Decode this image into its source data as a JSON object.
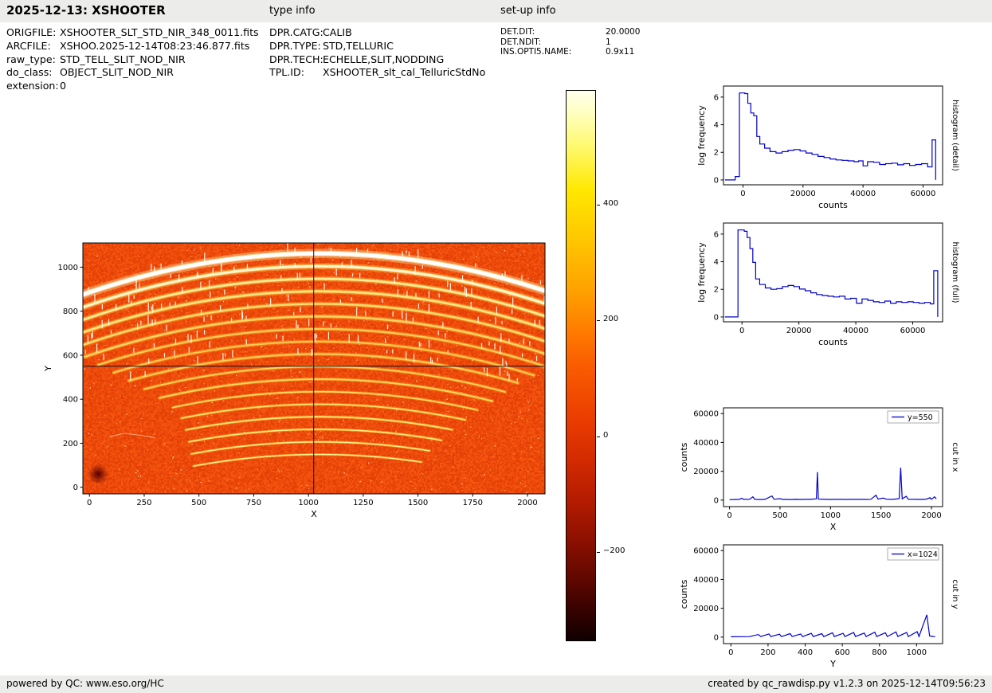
{
  "header": {
    "title": "2025-12-13: XSHOOTER",
    "type_info_heading": "type info",
    "setup_info_heading": "set-up info",
    "file_info": [
      {
        "label": "ORIGFILE:",
        "value": "XSHOOTER_SLT_STD_NIR_348_0011.fits"
      },
      {
        "label": "ARCFILE:",
        "value": "XSHOO.2025-12-14T08:23:46.877.fits"
      },
      {
        "label": "raw_type:",
        "value": "STD_TELL_SLIT_NOD_NIR"
      },
      {
        "label": "do_class:",
        "value": "OBJECT_SLIT_NOD_NIR"
      },
      {
        "label": "extension:",
        "value": "0"
      }
    ],
    "type_info": [
      {
        "label": "DPR.CATG:",
        "value": "CALIB"
      },
      {
        "label": "DPR.TYPE:",
        "value": "STD,TELLURIC"
      },
      {
        "label": "DPR.TECH:",
        "value": "ECHELLE,SLIT,NODDING"
      },
      {
        "label": "TPL.ID:",
        "value": "XSHOOTER_slt_cal_TelluricStdNo"
      }
    ],
    "setup_info": [
      {
        "label": "DET.DIT:",
        "value": "20.0000"
      },
      {
        "label": "DET.NDIT:",
        "value": "1"
      },
      {
        "label": "INS.OPTI5.NAME:",
        "value": "0.9x11"
      }
    ]
  },
  "footer": {
    "left": "powered by QC: www.eso.org/HC",
    "right": "created by qc_rawdisp.py v1.2.3 on 2025-12-14T09:56:23"
  },
  "accent_color": "#0000cc",
  "chart_data": [
    {
      "id": "raw_frame",
      "type": "heatmap",
      "title": "raw NIR echelle frame with curved spectral orders",
      "xlabel": "X",
      "ylabel": "Y",
      "xlim": [
        -30,
        2080
      ],
      "ylim": [
        -30,
        1110
      ],
      "xticks": [
        0,
        250,
        500,
        750,
        1000,
        1250,
        1500,
        1750,
        2000
      ],
      "yticks": [
        0,
        200,
        400,
        600,
        800,
        1000
      ],
      "crosshair": {
        "x": 1024,
        "y": 550
      },
      "colormap": "hot",
      "colorbar": {
        "tick_labels": [
          "400",
          "200",
          "0",
          "−200"
        ],
        "tick_values": [
          400,
          200,
          0,
          -200
        ],
        "range": [
          -355,
          599
        ]
      },
      "curvature": 0.00016,
      "apex_x": 1050,
      "noise": {
        "speckles": 650,
        "dark_spots": 220
      },
      "orders": [
        {
          "y": 1062,
          "x0": -40,
          "x1": 2090,
          "w": 9,
          "core": "#ffffff",
          "glow": "#ffeeaa",
          "dashes": true
        },
        {
          "y": 1004,
          "x0": -40,
          "x1": 2090,
          "w": 6,
          "core": "#fff6cc",
          "glow": "#ffd75e",
          "dashes": true
        },
        {
          "y": 947,
          "x0": -40,
          "x1": 2090,
          "w": 5,
          "core": "#ffec96",
          "glow": "#ffc646",
          "dashes": true
        },
        {
          "y": 890,
          "x0": -40,
          "x1": 2090,
          "w": 5,
          "core": "#ffe482",
          "glow": "#ffbc3a",
          "dashes": true
        },
        {
          "y": 833,
          "x0": -40,
          "x1": 2090,
          "w": 4.5,
          "core": "#ffdc72",
          "glow": "#ffb232",
          "dashes": true
        },
        {
          "y": 776,
          "x0": -20,
          "x1": 2090,
          "w": 4.5,
          "core": "#ffd466",
          "glow": "#ffaa2c",
          "dashes": true
        },
        {
          "y": 719,
          "x0": 40,
          "x1": 2090,
          "w": 4,
          "core": "#ffce5a",
          "glow": "#ffa226",
          "dashes": true
        },
        {
          "y": 662,
          "x0": 110,
          "x1": 2040,
          "w": 4,
          "core": "#ffc852",
          "glow": "#ff9c22",
          "dashes": true
        },
        {
          "y": 605,
          "x0": 180,
          "x1": 1970,
          "w": 4,
          "core": "#ffcc55",
          "glow": "#ff9e24",
          "dashes": true
        },
        {
          "y": 548,
          "x0": 250,
          "x1": 1900,
          "w": 3.5,
          "core": "#ffd25a",
          "glow": "#ffa226",
          "dashes": false
        },
        {
          "y": 491,
          "x0": 320,
          "x1": 1840,
          "w": 3.5,
          "core": "#ffd860",
          "glow": "#ffa828",
          "dashes": false
        },
        {
          "y": 434,
          "x0": 380,
          "x1": 1780,
          "w": 3,
          "core": "#ffde68",
          "glow": "#ffae2a",
          "dashes": false
        },
        {
          "y": 377,
          "x0": 420,
          "x1": 1720,
          "w": 3,
          "core": "#ffe470",
          "glow": "#ffb42e",
          "dashes": false
        },
        {
          "y": 320,
          "x0": 440,
          "x1": 1660,
          "w": 3,
          "core": "#ffea7a",
          "glow": "#ffba32",
          "dashes": false
        },
        {
          "y": 263,
          "x0": 455,
          "x1": 1610,
          "w": 2.8,
          "core": "#ffee84",
          "glow": "#ffc036",
          "dashes": false
        },
        {
          "y": 206,
          "x0": 465,
          "x1": 1565,
          "w": 2.6,
          "core": "#fff28e",
          "glow": "#ffc63a",
          "dashes": false
        },
        {
          "y": 149,
          "x0": 475,
          "x1": 1530,
          "w": 2.4,
          "core": "#fff698",
          "glow": "#ffcc3e",
          "dashes": false
        }
      ]
    },
    {
      "id": "histogram_detail",
      "type": "line",
      "step": true,
      "xlabel": "counts",
      "ylabel": "log frequency",
      "side_label": "histogram (detail)",
      "xlim": [
        -6500,
        66500
      ],
      "ylim": [
        -0.35,
        6.8
      ],
      "xticks": [
        0,
        20000,
        40000,
        60000
      ],
      "yticks": [
        0,
        2,
        4,
        6
      ],
      "color": "#0000cc",
      "points": [
        [
          -6000,
          0
        ],
        [
          -2600,
          0.25
        ],
        [
          -1200,
          6.3
        ],
        [
          600,
          6.25
        ],
        [
          1600,
          5.55
        ],
        [
          2600,
          4.85
        ],
        [
          3600,
          4.65
        ],
        [
          4600,
          3.15
        ],
        [
          5600,
          2.6
        ],
        [
          7200,
          2.3
        ],
        [
          9000,
          2.05
        ],
        [
          11000,
          1.95
        ],
        [
          13000,
          2.05
        ],
        [
          15000,
          2.15
        ],
        [
          17000,
          2.2
        ],
        [
          19000,
          2.1
        ],
        [
          21000,
          1.95
        ],
        [
          23000,
          1.85
        ],
        [
          25000,
          1.7
        ],
        [
          27000,
          1.62
        ],
        [
          29000,
          1.52
        ],
        [
          31000,
          1.45
        ],
        [
          33000,
          1.42
        ],
        [
          35000,
          1.38
        ],
        [
          37000,
          1.32
        ],
        [
          38500,
          1.38
        ],
        [
          40000,
          1.02
        ],
        [
          41500,
          1.32
        ],
        [
          43500,
          1.28
        ],
        [
          45500,
          1.12
        ],
        [
          47500,
          1.18
        ],
        [
          49500,
          1.22
        ],
        [
          51500,
          1.1
        ],
        [
          53500,
          1.18
        ],
        [
          55500,
          1.05
        ],
        [
          57500,
          1.12
        ],
        [
          59500,
          1.18
        ],
        [
          61500,
          0.95
        ],
        [
          63000,
          2.9
        ],
        [
          64200,
          0
        ]
      ]
    },
    {
      "id": "histogram_full",
      "type": "line",
      "step": true,
      "xlabel": "counts",
      "ylabel": "log frequency",
      "side_label": "histogram (full)",
      "xlim": [
        -6500,
        70500
      ],
      "ylim": [
        -0.35,
        6.8
      ],
      "xticks": [
        0,
        20000,
        40000,
        60000
      ],
      "yticks": [
        0,
        2,
        4,
        6
      ],
      "color": "#0000cc",
      "points": [
        [
          -6000,
          0
        ],
        [
          -1400,
          6.3
        ],
        [
          800,
          6.2
        ],
        [
          1800,
          5.75
        ],
        [
          2800,
          4.95
        ],
        [
          3800,
          3.95
        ],
        [
          4800,
          2.75
        ],
        [
          6200,
          2.35
        ],
        [
          8200,
          2.1
        ],
        [
          10200,
          2.0
        ],
        [
          12200,
          2.05
        ],
        [
          14200,
          2.2
        ],
        [
          16200,
          2.28
        ],
        [
          18200,
          2.2
        ],
        [
          20200,
          2.02
        ],
        [
          22200,
          1.9
        ],
        [
          24200,
          1.75
        ],
        [
          26200,
          1.62
        ],
        [
          28200,
          1.55
        ],
        [
          30200,
          1.5
        ],
        [
          32200,
          1.45
        ],
        [
          34200,
          1.5
        ],
        [
          36200,
          1.3
        ],
        [
          38200,
          1.35
        ],
        [
          40200,
          1.0
        ],
        [
          42200,
          1.3
        ],
        [
          44200,
          1.2
        ],
        [
          46200,
          1.1
        ],
        [
          48200,
          1.05
        ],
        [
          50200,
          1.15
        ],
        [
          52200,
          1.0
        ],
        [
          54200,
          1.1
        ],
        [
          56200,
          1.05
        ],
        [
          58200,
          1.1
        ],
        [
          60200,
          1.05
        ],
        [
          62200,
          1.0
        ],
        [
          64200,
          1.05
        ],
        [
          66200,
          0.95
        ],
        [
          67400,
          3.35
        ],
        [
          68800,
          0
        ]
      ]
    },
    {
      "id": "cut_x",
      "type": "line",
      "step": false,
      "xlabel": "X",
      "ylabel": "counts",
      "side_label": "cut in x",
      "legend": "y=550",
      "xlim": [
        -60,
        2110
      ],
      "ylim": [
        -4500,
        64000
      ],
      "xticks": [
        0,
        500,
        1000,
        1500,
        2000
      ],
      "yticks": [
        0,
        20000,
        40000,
        60000
      ],
      "color": "#0000cc",
      "points": [
        [
          0,
          300
        ],
        [
          50,
          400
        ],
        [
          100,
          500
        ],
        [
          120,
          1300
        ],
        [
          140,
          500
        ],
        [
          200,
          600
        ],
        [
          230,
          2300
        ],
        [
          250,
          500
        ],
        [
          300,
          400
        ],
        [
          350,
          500
        ],
        [
          420,
          2900
        ],
        [
          440,
          600
        ],
        [
          500,
          1000
        ],
        [
          520,
          500
        ],
        [
          600,
          400
        ],
        [
          650,
          500
        ],
        [
          700,
          450
        ],
        [
          750,
          550
        ],
        [
          800,
          500
        ],
        [
          860,
          900
        ],
        [
          870,
          19500
        ],
        [
          880,
          700
        ],
        [
          950,
          500
        ],
        [
          1000,
          450
        ],
        [
          1050,
          550
        ],
        [
          1100,
          500
        ],
        [
          1150,
          450
        ],
        [
          1200,
          500
        ],
        [
          1250,
          550
        ],
        [
          1300,
          500
        ],
        [
          1350,
          450
        ],
        [
          1400,
          600
        ],
        [
          1450,
          3400
        ],
        [
          1470,
          700
        ],
        [
          1520,
          1400
        ],
        [
          1560,
          600
        ],
        [
          1620,
          500
        ],
        [
          1680,
          1000
        ],
        [
          1695,
          22500
        ],
        [
          1710,
          900
        ],
        [
          1750,
          2600
        ],
        [
          1770,
          600
        ],
        [
          1850,
          500
        ],
        [
          1900,
          450
        ],
        [
          1950,
          700
        ],
        [
          1985,
          1700
        ],
        [
          2000,
          600
        ],
        [
          2030,
          2300
        ],
        [
          2048,
          800
        ]
      ]
    },
    {
      "id": "cut_y",
      "type": "line",
      "step": false,
      "xlabel": "Y",
      "ylabel": "counts",
      "side_label": "cut in y",
      "legend": "x=1024",
      "xlim": [
        -40,
        1140
      ],
      "ylim": [
        -4500,
        64000
      ],
      "xticks": [
        0,
        200,
        400,
        600,
        800,
        1000
      ],
      "yticks": [
        0,
        20000,
        40000,
        60000
      ],
      "color": "#0000cc",
      "points": [
        [
          0,
          250
        ],
        [
          60,
          300
        ],
        [
          100,
          350
        ],
        [
          148,
          1800
        ],
        [
          160,
          400
        ],
        [
          205,
          2200
        ],
        [
          215,
          400
        ],
        [
          262,
          2000
        ],
        [
          272,
          380
        ],
        [
          319,
          2400
        ],
        [
          330,
          400
        ],
        [
          376,
          2200
        ],
        [
          386,
          380
        ],
        [
          433,
          2600
        ],
        [
          443,
          400
        ],
        [
          490,
          2400
        ],
        [
          500,
          380
        ],
        [
          547,
          3000
        ],
        [
          557,
          420
        ],
        [
          604,
          2600
        ],
        [
          614,
          400
        ],
        [
          661,
          3200
        ],
        [
          671,
          420
        ],
        [
          718,
          2800
        ],
        [
          728,
          400
        ],
        [
          775,
          3400
        ],
        [
          785,
          430
        ],
        [
          832,
          3000
        ],
        [
          842,
          400
        ],
        [
          889,
          3600
        ],
        [
          899,
          430
        ],
        [
          946,
          3200
        ],
        [
          956,
          410
        ],
        [
          1003,
          3800
        ],
        [
          1013,
          450
        ],
        [
          1055,
          15500
        ],
        [
          1070,
          800
        ],
        [
          1090,
          400
        ],
        [
          1100,
          350
        ]
      ]
    }
  ]
}
